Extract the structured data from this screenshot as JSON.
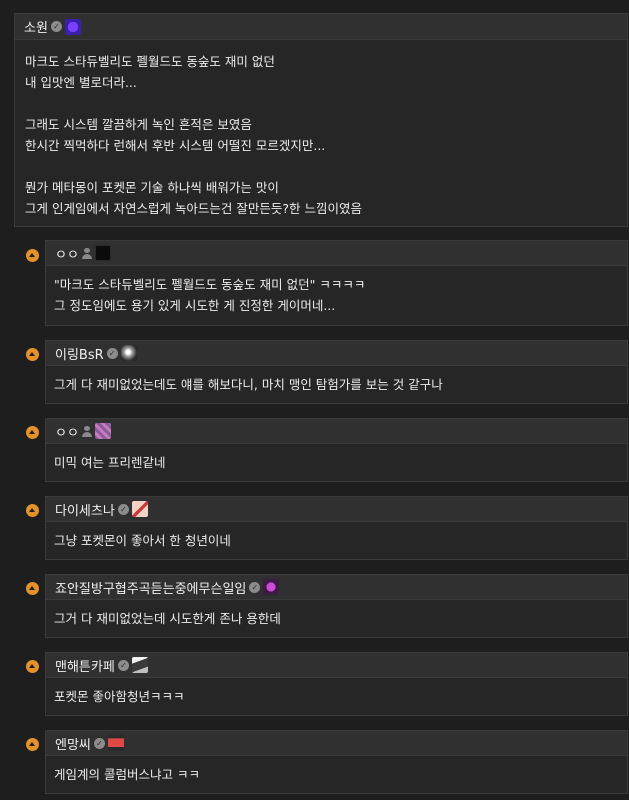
{
  "post": {
    "author": "소원",
    "lines": [
      "마크도 스타듀벨리도 펠월드도 동숲도 재미 없던",
      "내 입맛엔 별로더라...",
      "",
      "그래도 시스템 깔끔하게 녹인 흔적은 보였음",
      "한시간 찍먹하다 런해서 후반 시스템 어떨진 모르겠지만...",
      "",
      "뭔가 메타몽이 포켓몬 기술 하나씩 배워가는 맛이",
      "그게 인게임에서 자연스럽게 녹아드는건 잘만든듯?한 느낌이였음"
    ]
  },
  "replies": [
    {
      "author": "ㅇㅇ",
      "lines": [
        "\"마크도 스타듀벨리도 펠월드도 동숲도 재미 없던\" ㅋㅋㅋㅋ",
        "그 정도임에도 용기 있게 시도한 게 진정한 게이머네..."
      ]
    },
    {
      "author": "이링BsR",
      "lines": [
        "그게 다 재미없었는데도 얘를 해보다니, 마치 맹인 탐험가를 보는 것 같구나"
      ]
    },
    {
      "author": "ㅇㅇ",
      "lines": [
        "미믹 여는 프리렌같네"
      ]
    },
    {
      "author": "다이세츠나",
      "lines": [
        "그냥 포켓몬이 좋아서 한 청년이네"
      ]
    },
    {
      "author": "죠안질방구협주곡듣는중에무슨일임",
      "lines": [
        "그거 다 재미없었는데 시도한게 존나 용한데"
      ]
    },
    {
      "author": "맨해튼카페",
      "lines": [
        "포켓몬 좋아함청년ㅋㅋㅋ"
      ]
    },
    {
      "author": "엔망씨",
      "lines": [
        "게임계의 콜럼버스냐고 ㅋㅋ"
      ]
    }
  ]
}
